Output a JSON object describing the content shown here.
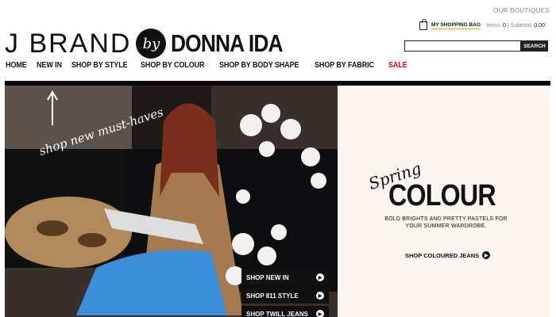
{
  "header": {
    "our_boutiques": "OUR BOUTIQUES",
    "bag_label": "MY SHOPPING BAG",
    "items_label": "Items:",
    "items_count": "0",
    "subtotal_label": "Subtotal:",
    "subtotal_value": "0.00",
    "search_placeholder": "",
    "search_button": "SEARCH"
  },
  "logo": {
    "left": "J BRAND",
    "by": "by",
    "right": "DONNA IDA"
  },
  "nav": [
    "HOME",
    "NEW IN",
    "SHOP BY STYLE",
    "SHOP BY COLOUR",
    "SHOP BY BODY SHAPE",
    "SHOP BY FABRIC",
    "SALE"
  ],
  "hero": {
    "scribble": "shop new must-haves",
    "buttons": [
      "SHOP NEW IN",
      "SHOP 811 STYLE",
      "SHOP TWILL JEANS"
    ]
  },
  "panel": {
    "spring": "Spring",
    "colour": "COLOUR",
    "sub": "BOLD BRIGHTS AND PRETTY PASTELS FOR YOUR SUMMER WARDROBE.",
    "cta": "SHOP COLOURED JEANS"
  },
  "colors": {
    "sale": "#e0001b",
    "accent_underline": "#d8b400",
    "panel_bg": "#fbf7f0"
  }
}
